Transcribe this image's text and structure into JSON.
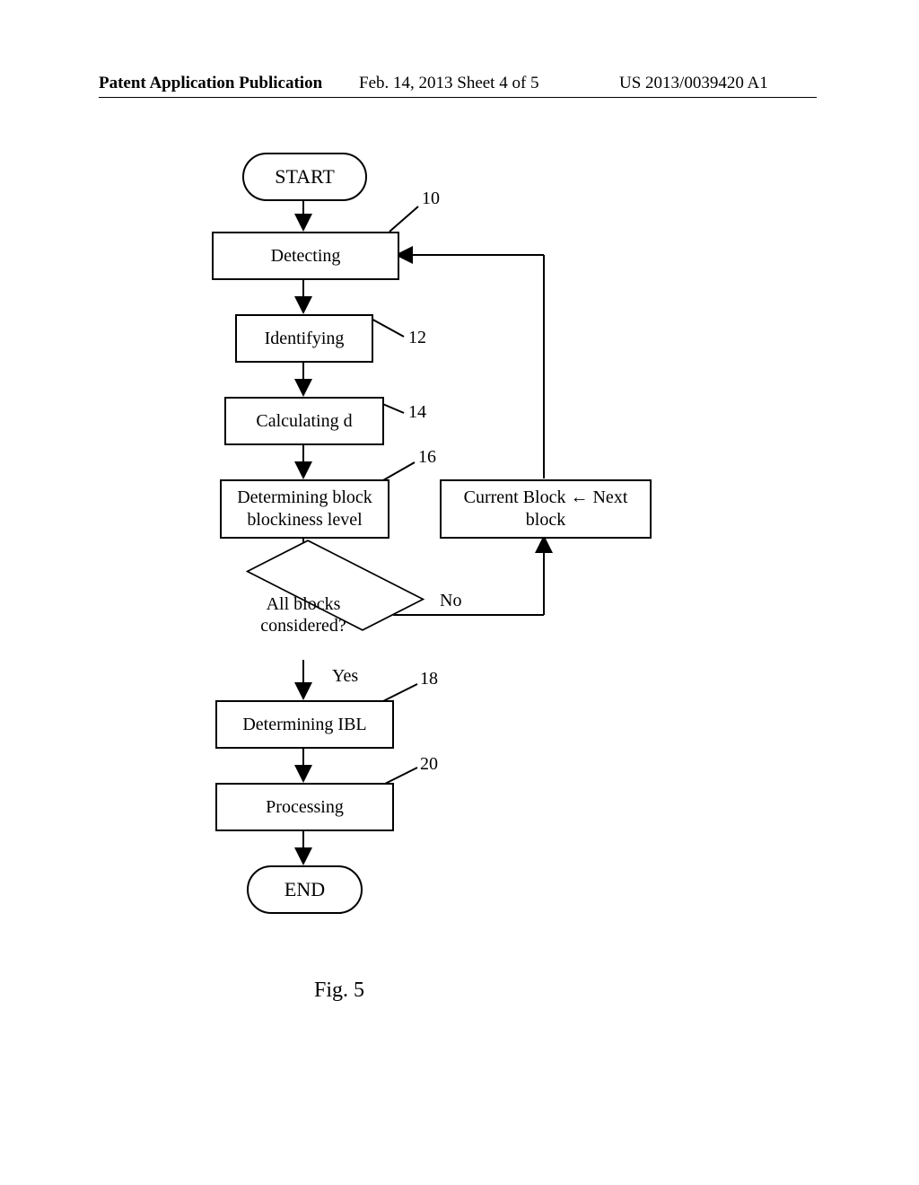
{
  "header": {
    "left": "Patent Application Publication",
    "center": "Feb. 14, 2013  Sheet 4 of 5",
    "right": "US 2013/0039420 A1"
  },
  "terminals": {
    "start": "START",
    "end": "END"
  },
  "processes": {
    "detecting": "Detecting",
    "identifying": "Identifying",
    "calculating": "Calculating d",
    "determining_block": "Determining block\nblockiness level",
    "next_block": "Current Block ← Next block",
    "determining_ibl": "Determining IBL",
    "processing": "Processing"
  },
  "decision": {
    "text": "All blocks\nconsidered?"
  },
  "labels": {
    "ref10": "10",
    "ref12": "12",
    "ref14": "14",
    "ref16": "16",
    "ref18": "18",
    "ref20": "20",
    "no": "No",
    "yes": "Yes"
  },
  "figure": "Fig. 5"
}
